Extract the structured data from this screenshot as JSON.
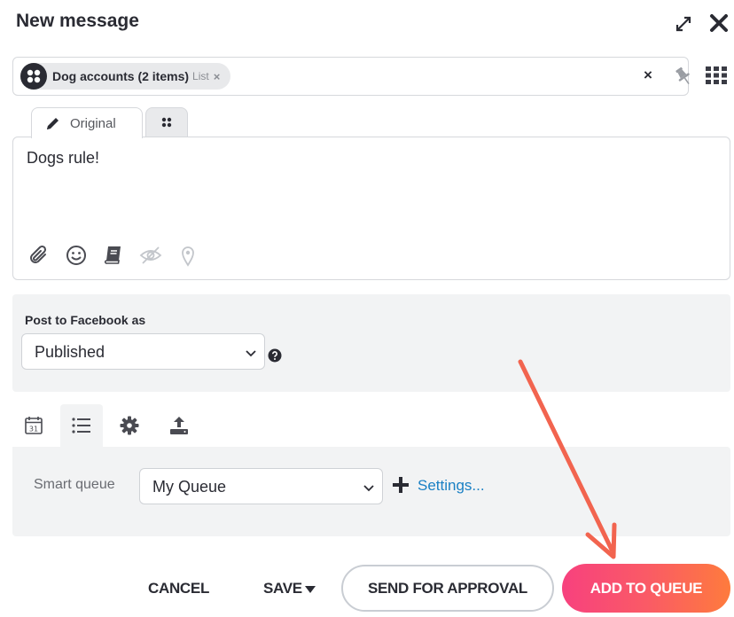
{
  "header": {
    "title": "New message"
  },
  "recipients": {
    "chip_label": "Dog accounts (2 items)",
    "chip_type": "List",
    "chip_remove": "×",
    "clear": "×"
  },
  "editor": {
    "tab_original": "Original",
    "text": "Dogs rule!"
  },
  "post_as": {
    "label": "Post to Facebook as",
    "selected": "Published"
  },
  "scheduling": {
    "label": "Smart queue",
    "queue_selected": "My Queue",
    "settings_link": "Settings..."
  },
  "footer": {
    "cancel": "CANCEL",
    "save": "SAVE",
    "send_for_approval": "SEND FOR APPROVAL",
    "add_to_queue": "ADD TO QUEUE"
  },
  "colors": {
    "primary_gradient_start": "#f7417e",
    "primary_gradient_end": "#fe7b3d",
    "link": "#1a80c4",
    "annotation_arrow": "#f2644f"
  }
}
